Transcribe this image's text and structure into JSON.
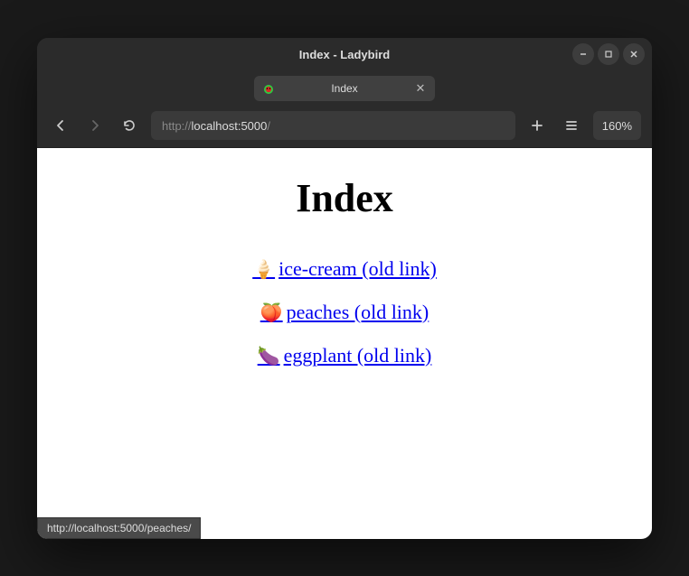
{
  "window": {
    "title": "Index - Ladybird"
  },
  "tab": {
    "title": "Index"
  },
  "toolbar": {
    "url_prefix": "http://",
    "url_host": "localhost:5000",
    "url_path": "/",
    "zoom": "160%"
  },
  "page": {
    "heading": "Index",
    "links": [
      {
        "emoji": "🍦",
        "text": "ice-cream (old link)"
      },
      {
        "emoji": "🍑",
        "text": "peaches (old link)"
      },
      {
        "emoji": "🍆",
        "text": "eggplant (old link)"
      }
    ]
  },
  "status": {
    "url": "http://localhost:5000/peaches/"
  }
}
